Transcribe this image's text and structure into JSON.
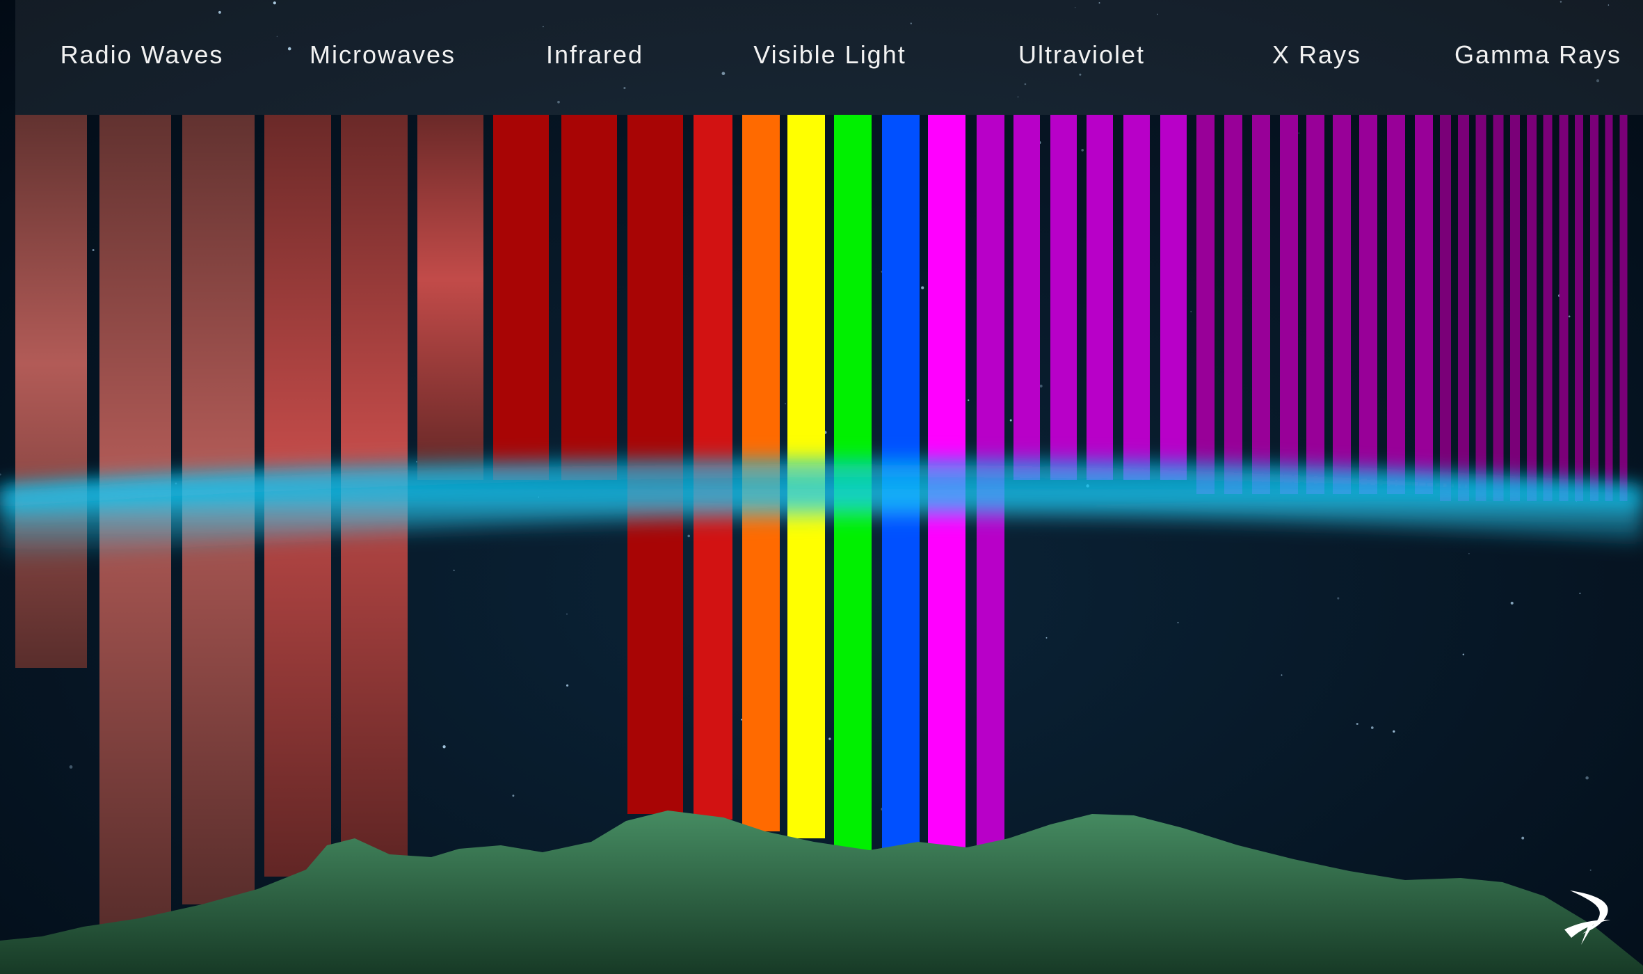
{
  "bands": [
    {
      "id": "radio",
      "label": "Radio Waves"
    },
    {
      "id": "microwave",
      "label": "Microwaves"
    },
    {
      "id": "infrared",
      "label": "Infrared"
    },
    {
      "id": "visible",
      "label": "Visible Light"
    },
    {
      "id": "ultraviolet",
      "label": "Ultraviolet"
    },
    {
      "id": "xray",
      "label": "X Rays"
    },
    {
      "id": "gamma",
      "label": "Gamma Rays"
    }
  ],
  "colors": {
    "radio": "#b25b57",
    "microwave": "#c24b49",
    "infrared": "#a80505",
    "red": "#d21212",
    "orange": "#ff6a00",
    "yellow": "#ffff00",
    "green": "#00f000",
    "blue": "#0050ff",
    "violet": "#ff00ff",
    "ultraviolet": "#b800c8",
    "xray": "#980098",
    "gamma": "#7a0078",
    "atmosphere_glow": "#12c3f0",
    "ground": "#3f7f55",
    "space": "#04111f"
  },
  "icons": {
    "logo": "swoosh-logo-icon"
  }
}
